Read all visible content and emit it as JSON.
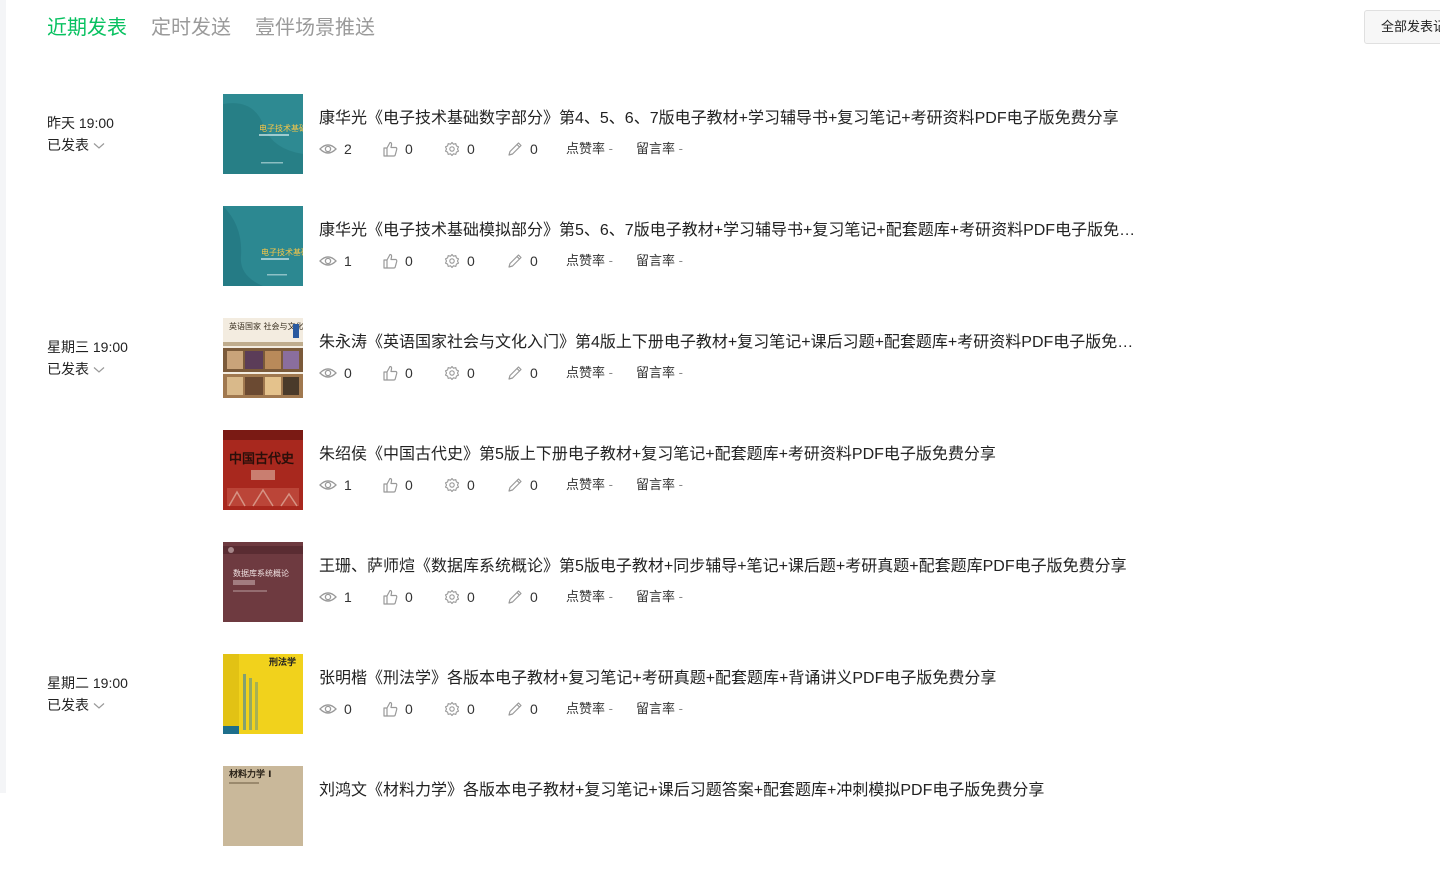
{
  "tabs": [
    {
      "label": "近期发表",
      "active": true
    },
    {
      "label": "定时发送",
      "active": false
    },
    {
      "label": "壹伴场景推送",
      "active": false
    }
  ],
  "all_button_label": "全部发表记",
  "colors": {
    "accent": "#07c160",
    "text": "#222222",
    "muted": "#9a9a9a"
  },
  "articles": [
    {
      "date": "昨天 19:00",
      "status": "已发表",
      "title": "康华光《电子技术基础数字部分》第4、5、6、7版电子教材+学习辅导书+复习笔记+考研资料PDF电子版免费分享",
      "views": "2",
      "likes": "0",
      "shares": "0",
      "edits": "0",
      "like_rate_label": "点赞率",
      "like_rate": "-",
      "comment_rate_label": "留言率",
      "comment_rate": "-",
      "cover_title": "电子技术基础"
    },
    {
      "date": "",
      "status": "",
      "title": "康华光《电子技术基础模拟部分》第5、6、7版电子教材+学习辅导书+复习笔记+配套题库+考研资料PDF电子版免费分享",
      "views": "1",
      "likes": "0",
      "shares": "0",
      "edits": "0",
      "like_rate_label": "点赞率",
      "like_rate": "-",
      "comment_rate_label": "留言率",
      "comment_rate": "-",
      "cover_title": "电子技术基础"
    },
    {
      "date": "星期三 19:00",
      "status": "已发表",
      "title": "朱永涛《英语国家社会与文化入门》第4版上下册电子教材+复习笔记+课后习题+配套题库+考研资料PDF电子版免费分享",
      "views": "0",
      "likes": "0",
      "shares": "0",
      "edits": "0",
      "like_rate_label": "点赞率",
      "like_rate": "-",
      "comment_rate_label": "留言率",
      "comment_rate": "-",
      "cover_title": "英语国家 社会与文化入门"
    },
    {
      "date": "",
      "status": "",
      "title": "朱绍侯《中国古代史》第5版上下册电子教材+复习笔记+配套题库+考研资料PDF电子版免费分享",
      "views": "1",
      "likes": "0",
      "shares": "0",
      "edits": "0",
      "like_rate_label": "点赞率",
      "like_rate": "-",
      "comment_rate_label": "留言率",
      "comment_rate": "-",
      "cover_title": "中国古代史"
    },
    {
      "date": "",
      "status": "",
      "title": "王珊、萨师煊《数据库系统概论》第5版电子教材+同步辅导+笔记+课后题+考研真题+配套题库PDF电子版免费分享",
      "views": "1",
      "likes": "0",
      "shares": "0",
      "edits": "0",
      "like_rate_label": "点赞率",
      "like_rate": "-",
      "comment_rate_label": "留言率",
      "comment_rate": "-",
      "cover_title": "数据库系统概论"
    },
    {
      "date": "星期二 19:00",
      "status": "已发表",
      "title": "张明楷《刑法学》各版本电子教材+复习笔记+考研真题+配套题库+背诵讲义PDF电子版免费分享",
      "views": "0",
      "likes": "0",
      "shares": "0",
      "edits": "0",
      "like_rate_label": "点赞率",
      "like_rate": "-",
      "comment_rate_label": "留言率",
      "comment_rate": "-",
      "cover_title": "刑法学"
    },
    {
      "date": "",
      "status": "",
      "title": "刘鸿文《材料力学》各版本电子教材+复习笔记+课后习题答案+配套题库+冲刺模拟PDF电子版免费分享",
      "views": "",
      "likes": "",
      "shares": "",
      "edits": "",
      "like_rate_label": "",
      "like_rate": "",
      "comment_rate_label": "",
      "comment_rate": "",
      "cover_title": "材料力学 I"
    }
  ]
}
